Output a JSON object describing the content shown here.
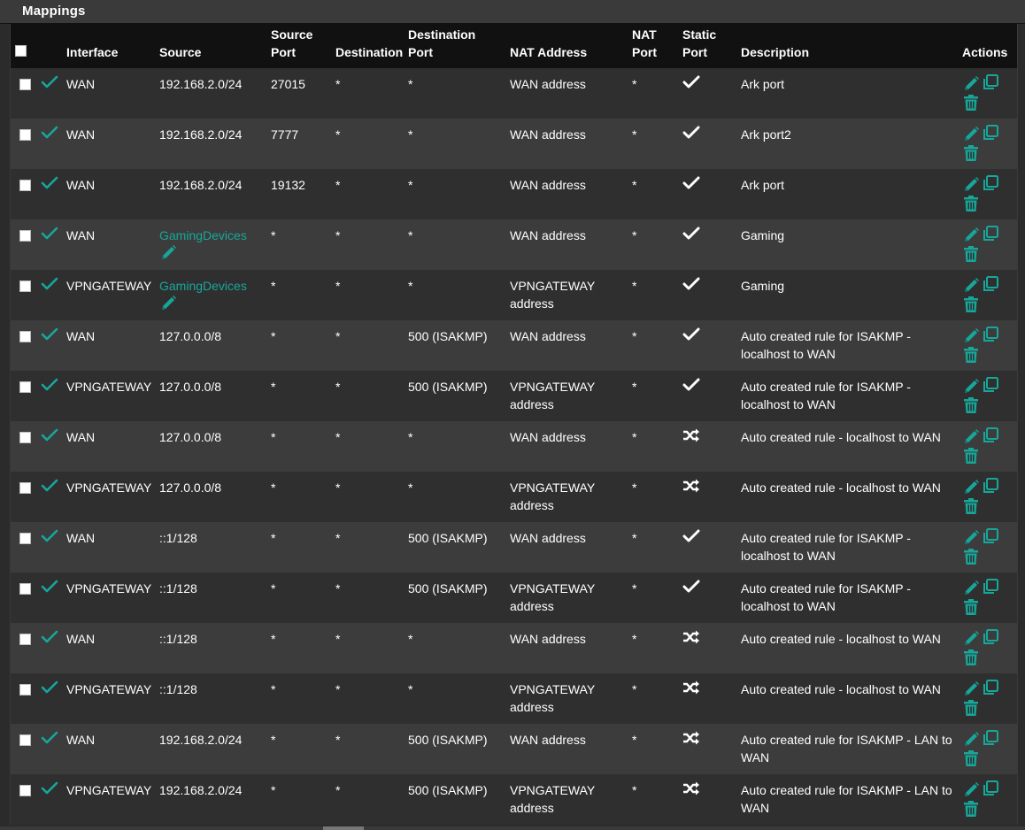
{
  "panel": {
    "title": "Mappings"
  },
  "columns": {
    "interface": "Interface",
    "source": "Source",
    "source_port": "Source Port",
    "destination": "Destination",
    "destination_port": "Destination Port",
    "nat_address": "NAT Address",
    "nat_port": "NAT Port",
    "static_port": "Static Port",
    "description": "Description",
    "actions": "Actions"
  },
  "colors": {
    "accent": "#17a79a",
    "header_bg": "#111111",
    "row_odd": "#2f2f2f",
    "row_even": "#3c3c3c"
  },
  "rows": [
    {
      "interface": "WAN",
      "source": "192.168.2.0/24",
      "source_is_alias": false,
      "source_port": "27015",
      "destination": "*",
      "destination_port": "*",
      "nat_address": "WAN address",
      "nat_port": "*",
      "static_port": "check-icon",
      "description": "Ark port"
    },
    {
      "interface": "WAN",
      "source": "192.168.2.0/24",
      "source_is_alias": false,
      "source_port": "7777",
      "destination": "*",
      "destination_port": "*",
      "nat_address": "WAN address",
      "nat_port": "*",
      "static_port": "check-icon",
      "description": "Ark port2"
    },
    {
      "interface": "WAN",
      "source": "192.168.2.0/24",
      "source_is_alias": false,
      "source_port": "19132",
      "destination": "*",
      "destination_port": "*",
      "nat_address": "WAN address",
      "nat_port": "*",
      "static_port": "check-icon",
      "description": "Ark port"
    },
    {
      "interface": "WAN",
      "source": "GamingDevices",
      "source_is_alias": true,
      "source_port": "*",
      "destination": "*",
      "destination_port": "*",
      "nat_address": "WAN address",
      "nat_port": "*",
      "static_port": "check-icon",
      "description": "Gaming"
    },
    {
      "interface": "VPNGATEWAY",
      "source": "GamingDevices",
      "source_is_alias": true,
      "source_port": "*",
      "destination": "*",
      "destination_port": "*",
      "nat_address": "VPNGATEWAY address",
      "nat_port": "*",
      "static_port": "check-icon",
      "description": "Gaming"
    },
    {
      "interface": "WAN",
      "source": "127.0.0.0/8",
      "source_is_alias": false,
      "source_port": "*",
      "destination": "*",
      "destination_port": "500 (ISAKMP)",
      "nat_address": "WAN address",
      "nat_port": "*",
      "static_port": "check-icon",
      "description": "Auto created rule for ISAKMP - localhost to WAN"
    },
    {
      "interface": "VPNGATEWAY",
      "source": "127.0.0.0/8",
      "source_is_alias": false,
      "source_port": "*",
      "destination": "*",
      "destination_port": "500 (ISAKMP)",
      "nat_address": "VPNGATEWAY address",
      "nat_port": "*",
      "static_port": "check-icon",
      "description": "Auto created rule for ISAKMP - localhost to WAN"
    },
    {
      "interface": "WAN",
      "source": "127.0.0.0/8",
      "source_is_alias": false,
      "source_port": "*",
      "destination": "*",
      "destination_port": "*",
      "nat_address": "WAN address",
      "nat_port": "*",
      "static_port": "shuffle-icon",
      "description": "Auto created rule - localhost to WAN"
    },
    {
      "interface": "VPNGATEWAY",
      "source": "127.0.0.0/8",
      "source_is_alias": false,
      "source_port": "*",
      "destination": "*",
      "destination_port": "*",
      "nat_address": "VPNGATEWAY address",
      "nat_port": "*",
      "static_port": "shuffle-icon",
      "description": "Auto created rule - localhost to WAN"
    },
    {
      "interface": "WAN",
      "source": "::1/128",
      "source_is_alias": false,
      "source_port": "*",
      "destination": "*",
      "destination_port": "500 (ISAKMP)",
      "nat_address": "WAN address",
      "nat_port": "*",
      "static_port": "check-icon",
      "description": "Auto created rule for ISAKMP - localhost to WAN"
    },
    {
      "interface": "VPNGATEWAY",
      "source": "::1/128",
      "source_is_alias": false,
      "source_port": "*",
      "destination": "*",
      "destination_port": "500 (ISAKMP)",
      "nat_address": "VPNGATEWAY address",
      "nat_port": "*",
      "static_port": "check-icon",
      "description": "Auto created rule for ISAKMP - localhost to WAN"
    },
    {
      "interface": "WAN",
      "source": "::1/128",
      "source_is_alias": false,
      "source_port": "*",
      "destination": "*",
      "destination_port": "*",
      "nat_address": "WAN address",
      "nat_port": "*",
      "static_port": "shuffle-icon",
      "description": "Auto created rule - localhost to WAN"
    },
    {
      "interface": "VPNGATEWAY",
      "source": "::1/128",
      "source_is_alias": false,
      "source_port": "*",
      "destination": "*",
      "destination_port": "*",
      "nat_address": "VPNGATEWAY address",
      "nat_port": "*",
      "static_port": "shuffle-icon",
      "description": "Auto created rule - localhost to WAN"
    },
    {
      "interface": "WAN",
      "source": "192.168.2.0/24",
      "source_is_alias": false,
      "source_port": "*",
      "destination": "*",
      "destination_port": "500 (ISAKMP)",
      "nat_address": "WAN address",
      "nat_port": "*",
      "static_port": "shuffle-icon",
      "description": "Auto created rule for ISAKMP - LAN to WAN"
    },
    {
      "interface": "VPNGATEWAY",
      "source": "192.168.2.0/24",
      "source_is_alias": false,
      "source_port": "*",
      "destination": "*",
      "destination_port": "500 (ISAKMP)",
      "nat_address": "VPNGATEWAY address",
      "nat_port": "*",
      "static_port": "shuffle-icon",
      "description": "Auto created rule for ISAKMP - LAN to WAN"
    }
  ]
}
